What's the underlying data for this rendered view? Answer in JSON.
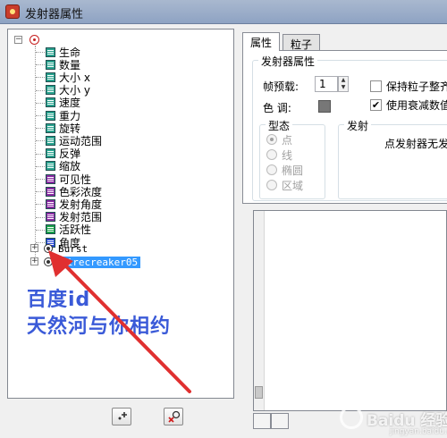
{
  "window": {
    "title": "发射器属性"
  },
  "tree": {
    "items": [
      {
        "label": "生命",
        "color": "#2aa38f"
      },
      {
        "label": "数量",
        "color": "#2aa38f"
      },
      {
        "label": "大小 x",
        "color": "#2aa38f"
      },
      {
        "label": "大小 y",
        "color": "#2aa38f"
      },
      {
        "label": "速度",
        "color": "#2aa38f"
      },
      {
        "label": "重力",
        "color": "#2aa38f"
      },
      {
        "label": "旋转",
        "color": "#2aa38f"
      },
      {
        "label": "运动范围",
        "color": "#2aa38f"
      },
      {
        "label": "反弹",
        "color": "#2aa38f"
      },
      {
        "label": "缩放",
        "color": "#2aa38f"
      },
      {
        "label": "可见性",
        "color": "#8a2aa3"
      },
      {
        "label": "色彩浓度",
        "color": "#8a2aa3"
      },
      {
        "label": "发射角度",
        "color": "#8a2aa3"
      },
      {
        "label": "发射范围",
        "color": "#8a2aa3"
      },
      {
        "label": "活跃性",
        "color": "#1aa24a"
      },
      {
        "label": "角度",
        "color": "#2a4ad8"
      }
    ],
    "emitters": [
      {
        "label": "Burst",
        "selected": false
      },
      {
        "label": "firecreaker05",
        "selected": true
      }
    ]
  },
  "watermark": {
    "line1": "百度id",
    "line2": "天然河与你相约"
  },
  "toolbar": {
    "add_icon": "add-emitter-icon",
    "delete_icon": "delete-emitter-icon"
  },
  "tabs": [
    {
      "label": "属性",
      "active": true
    },
    {
      "label": "粒子",
      "active": false
    }
  ],
  "props": {
    "group_title": "发射器属性",
    "preload_label": "帧预载:",
    "preload_value": "1",
    "hue_label": "色 调:",
    "hue_color": "#777777",
    "keep_particles_label": "保持粒子整齐",
    "keep_particles_checked": false,
    "use_decay_label": "使用衰减数值",
    "use_decay_checked": true,
    "shape_group_title": "型态",
    "shapes": [
      {
        "label": "点",
        "checked": true
      },
      {
        "label": "线",
        "checked": false
      },
      {
        "label": "椭圆",
        "checked": false
      },
      {
        "label": "区域",
        "checked": false
      }
    ],
    "emit_group_title": "发射",
    "emit_note": "点发射器无发"
  },
  "logo": {
    "text": "Baidu 经验",
    "sub": "jingyan.baidu.com"
  }
}
